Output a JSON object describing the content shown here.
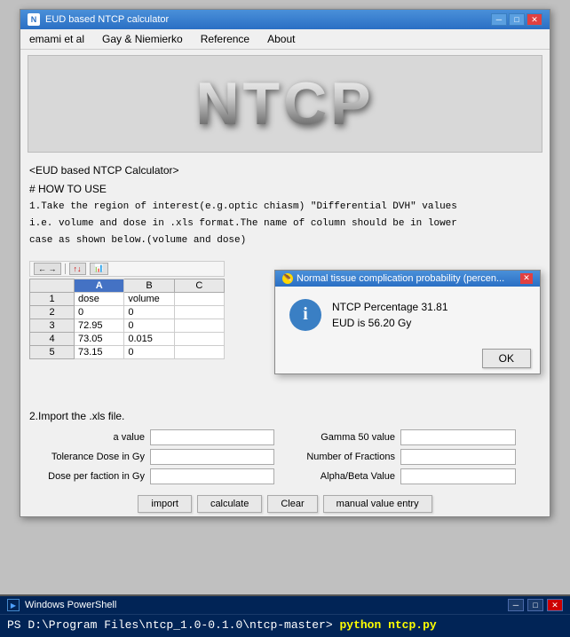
{
  "window": {
    "title": "EUD based NTCP calculator",
    "icon": "N"
  },
  "menu": {
    "items": [
      "emami et al",
      "Gay & Niemierko",
      "Reference",
      "About"
    ]
  },
  "logo": {
    "text": "NTCP"
  },
  "instructions": {
    "line1": "<EUD based NTCP Calculator>",
    "line2": "# HOW TO USE",
    "line3": "1.Take the region of interest(e.g.optic chiasm) \"Differential DVH\" values",
    "line4": "i.e. volume and dose in .xls format.The name of column should be in lower",
    "line5": "case as shown below.(volume and dose)"
  },
  "spreadsheet": {
    "toolbar_items": [
      "← →",
      "|",
      "↑ ↓"
    ],
    "columns": [
      "A",
      "B",
      "C"
    ],
    "headers": [
      "dose",
      "volume",
      ""
    ],
    "rows": [
      {
        "row": "2",
        "a": "0",
        "b": "0"
      },
      {
        "row": "3",
        "a": "72.95",
        "b": "0"
      },
      {
        "row": "4",
        "a": "73.05",
        "b": "0.015"
      },
      {
        "row": "5",
        "a": "73.15",
        "b": "0"
      }
    ]
  },
  "dialog": {
    "title": "Normal tissue complication probability (percen...",
    "close_label": "✕",
    "info_icon": "i",
    "line1": "NTCP Percentage 31.81",
    "line2": "EUD is 56.20 Gy",
    "ok_label": "OK"
  },
  "import_text": "2.Import the .xls file.",
  "form": {
    "fields_left": [
      {
        "label": "a value",
        "id": "a-value"
      },
      {
        "label": "Tolerance Dose in Gy",
        "id": "tol-dose"
      },
      {
        "label": "Dose per faction in Gy",
        "id": "dose-per-faction"
      }
    ],
    "fields_right": [
      {
        "label": "Gamma 50 value",
        "id": "gamma50"
      },
      {
        "label": "Number of Fractions",
        "id": "num-fractions"
      },
      {
        "label": "Alpha/Beta Value",
        "id": "alpha-beta"
      }
    ]
  },
  "buttons": {
    "import": "import",
    "calculate": "calculate",
    "clear": "Clear",
    "manual": "manual value entry"
  },
  "powershell": {
    "title": "Windows PowerShell",
    "icon": ">_",
    "prompt": "PS D:\\Program Files\\ntcp_1.0-0.1.0\\ntcp-master>",
    "command": " python ntcp.py"
  }
}
